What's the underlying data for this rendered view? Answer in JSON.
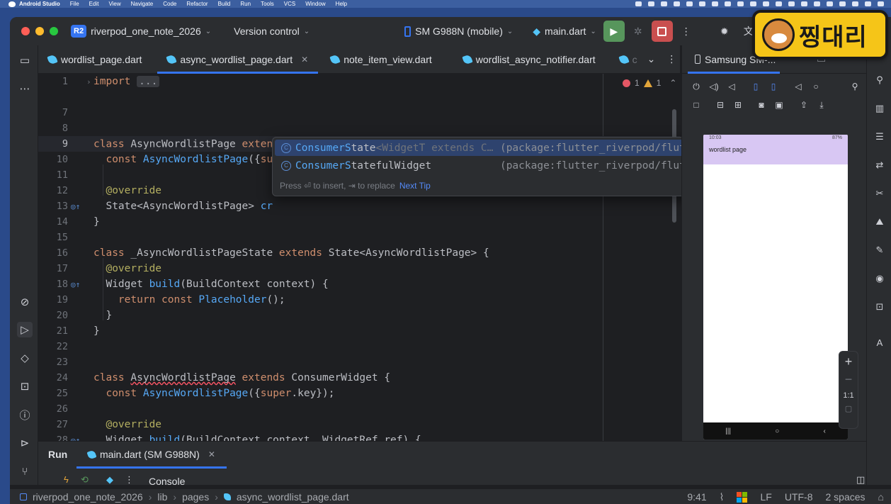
{
  "menubar": {
    "app": "Android Studio",
    "items": [
      "File",
      "Edit",
      "View",
      "Navigate",
      "Code",
      "Refactor",
      "Build",
      "Run",
      "Tools",
      "VCS",
      "Window",
      "Help"
    ]
  },
  "toolbar": {
    "project_badge": "R2",
    "project_name": "riverpod_one_note_2026",
    "vcs": "Version control",
    "device": "SM G988N (mobile)",
    "run_config": "main.dart"
  },
  "tabs": [
    {
      "label": "wordlist_page.dart",
      "active": false
    },
    {
      "label": "async_wordlist_page.dart",
      "active": true
    },
    {
      "label": "note_item_view.dart",
      "active": false
    },
    {
      "label": "wordlist_async_notifier.dart",
      "active": false
    },
    {
      "label": "c",
      "active": false
    }
  ],
  "editor": {
    "errors": "1",
    "warnings": "1",
    "fold_text": "..."
  },
  "completion": {
    "items": [
      {
        "typed": "ConsumerS",
        "rest": "tate",
        "tail": "<WidgetT extends C…",
        "pkg": "(package:flutter_riverpod/flutter_riverpod.dart)"
      },
      {
        "typed": "ConsumerS",
        "rest": "tatefulWidget",
        "tail": "",
        "pkg": "(package:flutter_riverpod/flutter_riverpod.dart)"
      }
    ],
    "hint": "Press ⏎ to insert, ⇥ to replace",
    "next_tip": "Next Tip"
  },
  "device_panel": {
    "title": "Samsung SM-...",
    "phone_time": "10:03",
    "phone_status_right": "87%",
    "phone_appbar": "wordlist page",
    "zoom_ratio": "1:1"
  },
  "run_panel": {
    "title": "Run",
    "tab": "main.dart (SM G988N)",
    "console": "Console"
  },
  "statusbar": {
    "crumbs": [
      "riverpod_one_note_2026",
      "lib",
      "pages",
      "async_wordlist_page.dart"
    ],
    "position": "9:41",
    "line_sep": "LF",
    "encoding": "UTF-8",
    "indent": "2 spaces"
  },
  "watermark": {
    "text": "찡대리"
  }
}
